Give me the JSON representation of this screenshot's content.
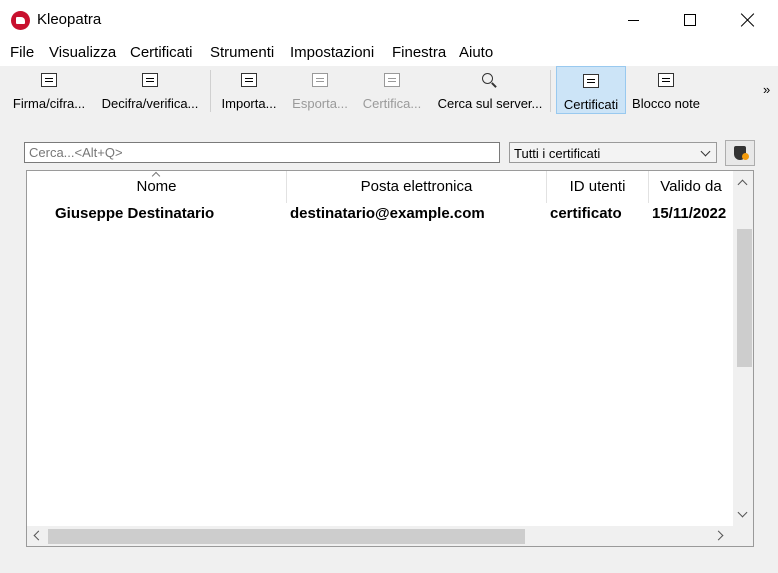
{
  "window": {
    "title": "Kleopatra"
  },
  "menu": [
    "File",
    "Visualizza",
    "Certificati",
    "Strumenti",
    "Impostazioni",
    "Finestra",
    "Aiuto"
  ],
  "toolbar": {
    "sign_encrypt": "Firma/cifra...",
    "decrypt_verify": "Decifra/verifica...",
    "import": "Importa...",
    "export": "Esporta...",
    "certify": "Certifica...",
    "lookup_server": "Cerca sul server...",
    "certificates": "Certificati",
    "notepad": "Blocco note",
    "more": "»"
  },
  "filter": {
    "search_placeholder": "Cerca...<Alt+Q>",
    "search_value": "",
    "selected_filter": "Tutti i certificati"
  },
  "table": {
    "headers": [
      "Nome",
      "Posta elettronica",
      "ID utenti",
      "Valido da"
    ],
    "rows": [
      {
        "name": "Giuseppe Destinatario",
        "email": "destinatario@example.com",
        "user_ids": "certificato",
        "valid_from": "15/11/2022"
      }
    ]
  },
  "colors": {
    "active_toolbar_bg": "#cce4f7",
    "app_icon": "#c8102e"
  }
}
